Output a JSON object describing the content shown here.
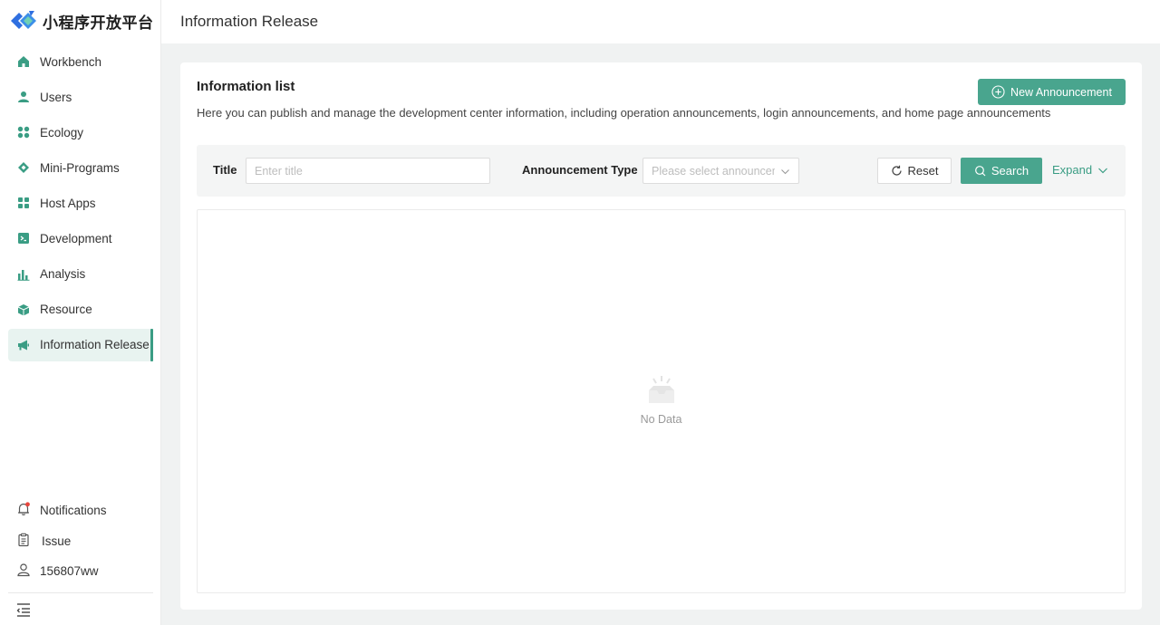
{
  "brand": {
    "name": "小程序开放平台"
  },
  "sidebar": {
    "items": [
      {
        "label": "Workbench",
        "icon": "home-icon"
      },
      {
        "label": "Users",
        "icon": "user-icon"
      },
      {
        "label": "Ecology",
        "icon": "grid-icon"
      },
      {
        "label": "Mini-Programs",
        "icon": "diamond-icon"
      },
      {
        "label": "Host Apps",
        "icon": "apps-icon"
      },
      {
        "label": "Development",
        "icon": "terminal-icon"
      },
      {
        "label": "Analysis",
        "icon": "bar-chart-icon"
      },
      {
        "label": "Resource",
        "icon": "cube-icon"
      },
      {
        "label": "Information Release",
        "icon": "megaphone-icon",
        "active": true
      }
    ],
    "bottom": [
      {
        "label": "Notifications",
        "icon": "bell-icon"
      },
      {
        "label": "Issue",
        "icon": "clipboard-icon"
      },
      {
        "label": "156807ww",
        "icon": "user-outline-icon"
      }
    ]
  },
  "header": {
    "title": "Information Release"
  },
  "card": {
    "title": "Information list",
    "description": "Here you can publish and manage the development center information, including operation announcements, login announcements, and home page announcements",
    "new_button": "New Announcement"
  },
  "filter": {
    "title_label": "Title",
    "title_placeholder": "Enter title",
    "type_label": "Announcement Type",
    "type_placeholder": "Please select announcement type",
    "reset_label": "Reset",
    "search_label": "Search",
    "expand_label": "Expand"
  },
  "table": {
    "empty_text": "No Data"
  },
  "colors": {
    "accent": "#49a58e",
    "accent_dark": "#3a9d84",
    "active_bg": "#e8f3f0",
    "logo_blue": "#2f6fe0",
    "logo_teal": "#3cb29a",
    "notify_dot": "#e8453c"
  }
}
